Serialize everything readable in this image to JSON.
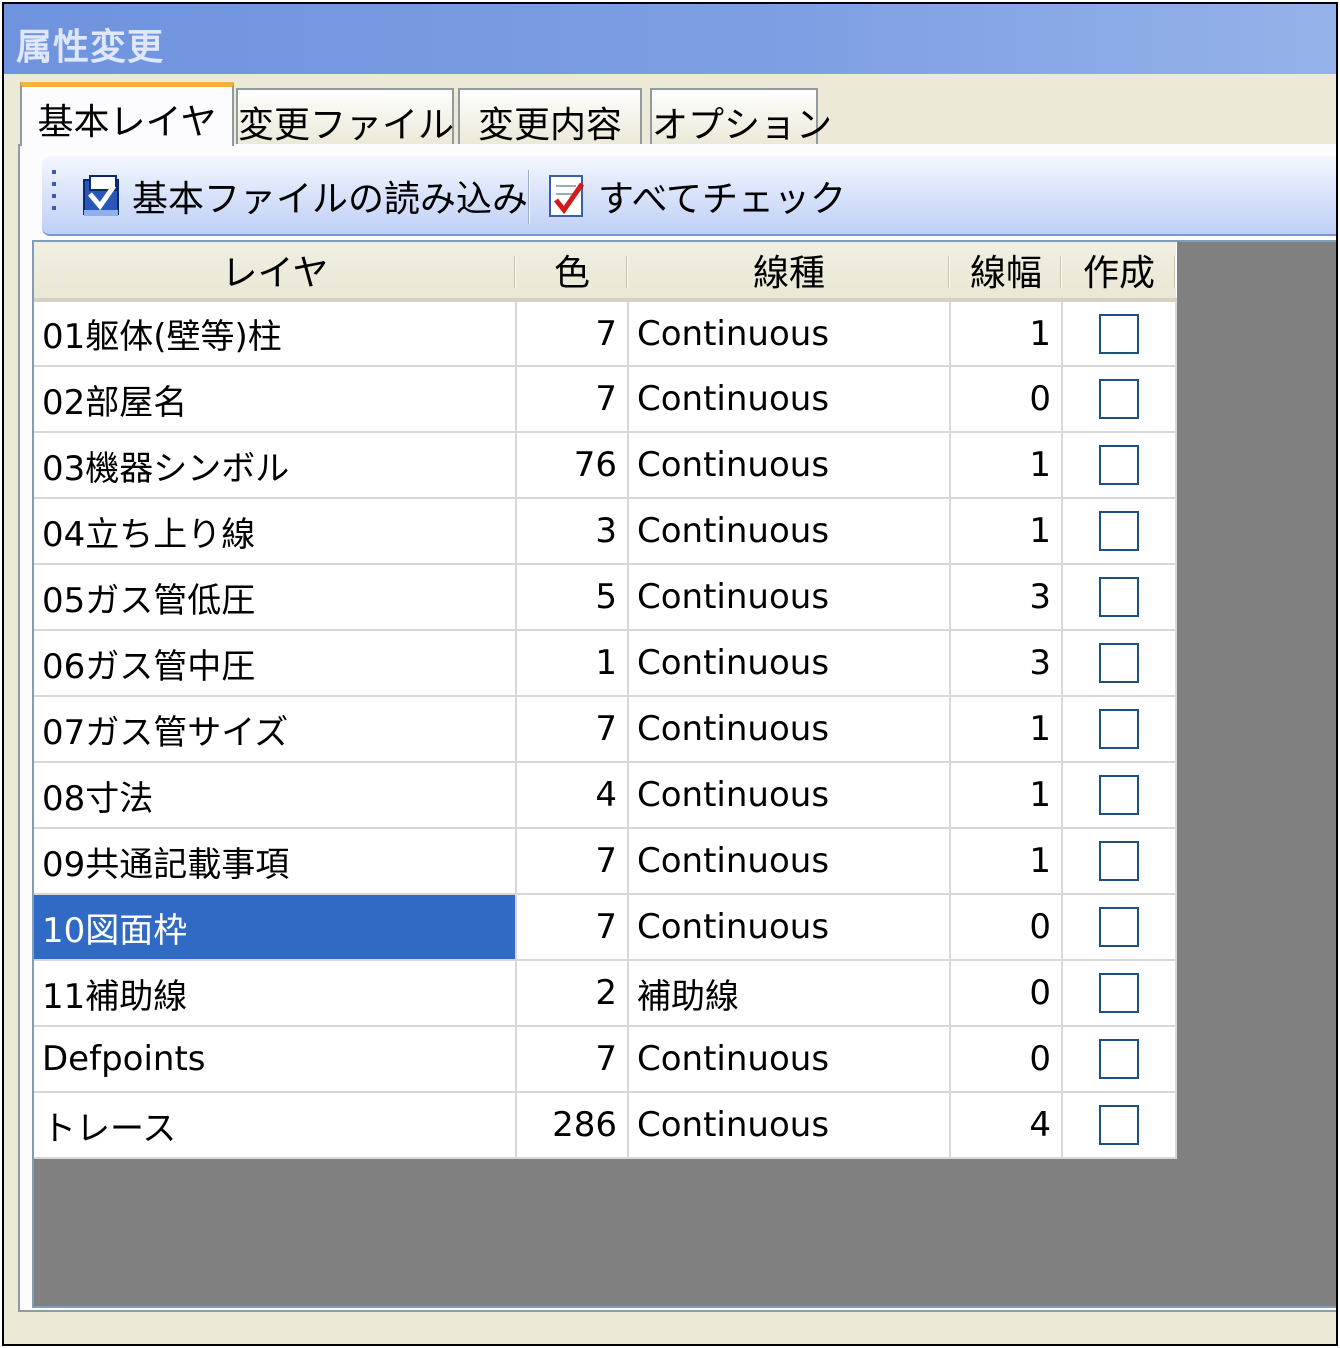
{
  "window": {
    "title": "属性変更"
  },
  "tabs": [
    {
      "label": "基本レイヤ",
      "active": true
    },
    {
      "label": "変更ファイル",
      "active": false
    },
    {
      "label": "変更内容",
      "active": false
    },
    {
      "label": "オプション",
      "active": false
    }
  ],
  "toolbar": {
    "load_label": "基本ファイルの読み込み",
    "load_icon": "open-folder-icon",
    "check_all_label": "すべてチェック",
    "check_all_icon": "checklist-icon"
  },
  "grid": {
    "columns": [
      "レイヤ",
      "色",
      "線種",
      "線幅",
      "作成"
    ],
    "selected_row": 9,
    "selection_color": "#316ac5",
    "rows": [
      {
        "layer": "01躯体(壁等)柱",
        "color": "7",
        "linetype": "Continuous",
        "width": "1",
        "create": false
      },
      {
        "layer": "02部屋名",
        "color": "7",
        "linetype": "Continuous",
        "width": "0",
        "create": false
      },
      {
        "layer": "03機器シンボル",
        "color": "76",
        "linetype": "Continuous",
        "width": "1",
        "create": false
      },
      {
        "layer": "04立ち上り線",
        "color": "3",
        "linetype": "Continuous",
        "width": "1",
        "create": false
      },
      {
        "layer": "05ガス管低圧",
        "color": "5",
        "linetype": "Continuous",
        "width": "3",
        "create": false
      },
      {
        "layer": "06ガス管中圧",
        "color": "1",
        "linetype": "Continuous",
        "width": "3",
        "create": false
      },
      {
        "layer": "07ガス管サイズ",
        "color": "7",
        "linetype": "Continuous",
        "width": "1",
        "create": false
      },
      {
        "layer": "08寸法",
        "color": "4",
        "linetype": "Continuous",
        "width": "1",
        "create": false
      },
      {
        "layer": "09共通記載事項",
        "color": "7",
        "linetype": "Continuous",
        "width": "1",
        "create": false
      },
      {
        "layer": "10図面枠",
        "color": "7",
        "linetype": "Continuous",
        "width": "0",
        "create": false
      },
      {
        "layer": "11補助線",
        "color": "2",
        "linetype": "補助線",
        "width": "0",
        "create": false
      },
      {
        "layer": "Defpoints",
        "color": "7",
        "linetype": "Continuous",
        "width": "0",
        "create": false
      },
      {
        "layer": "トレース",
        "color": "286",
        "linetype": "Continuous",
        "width": "4",
        "create": false
      }
    ]
  }
}
